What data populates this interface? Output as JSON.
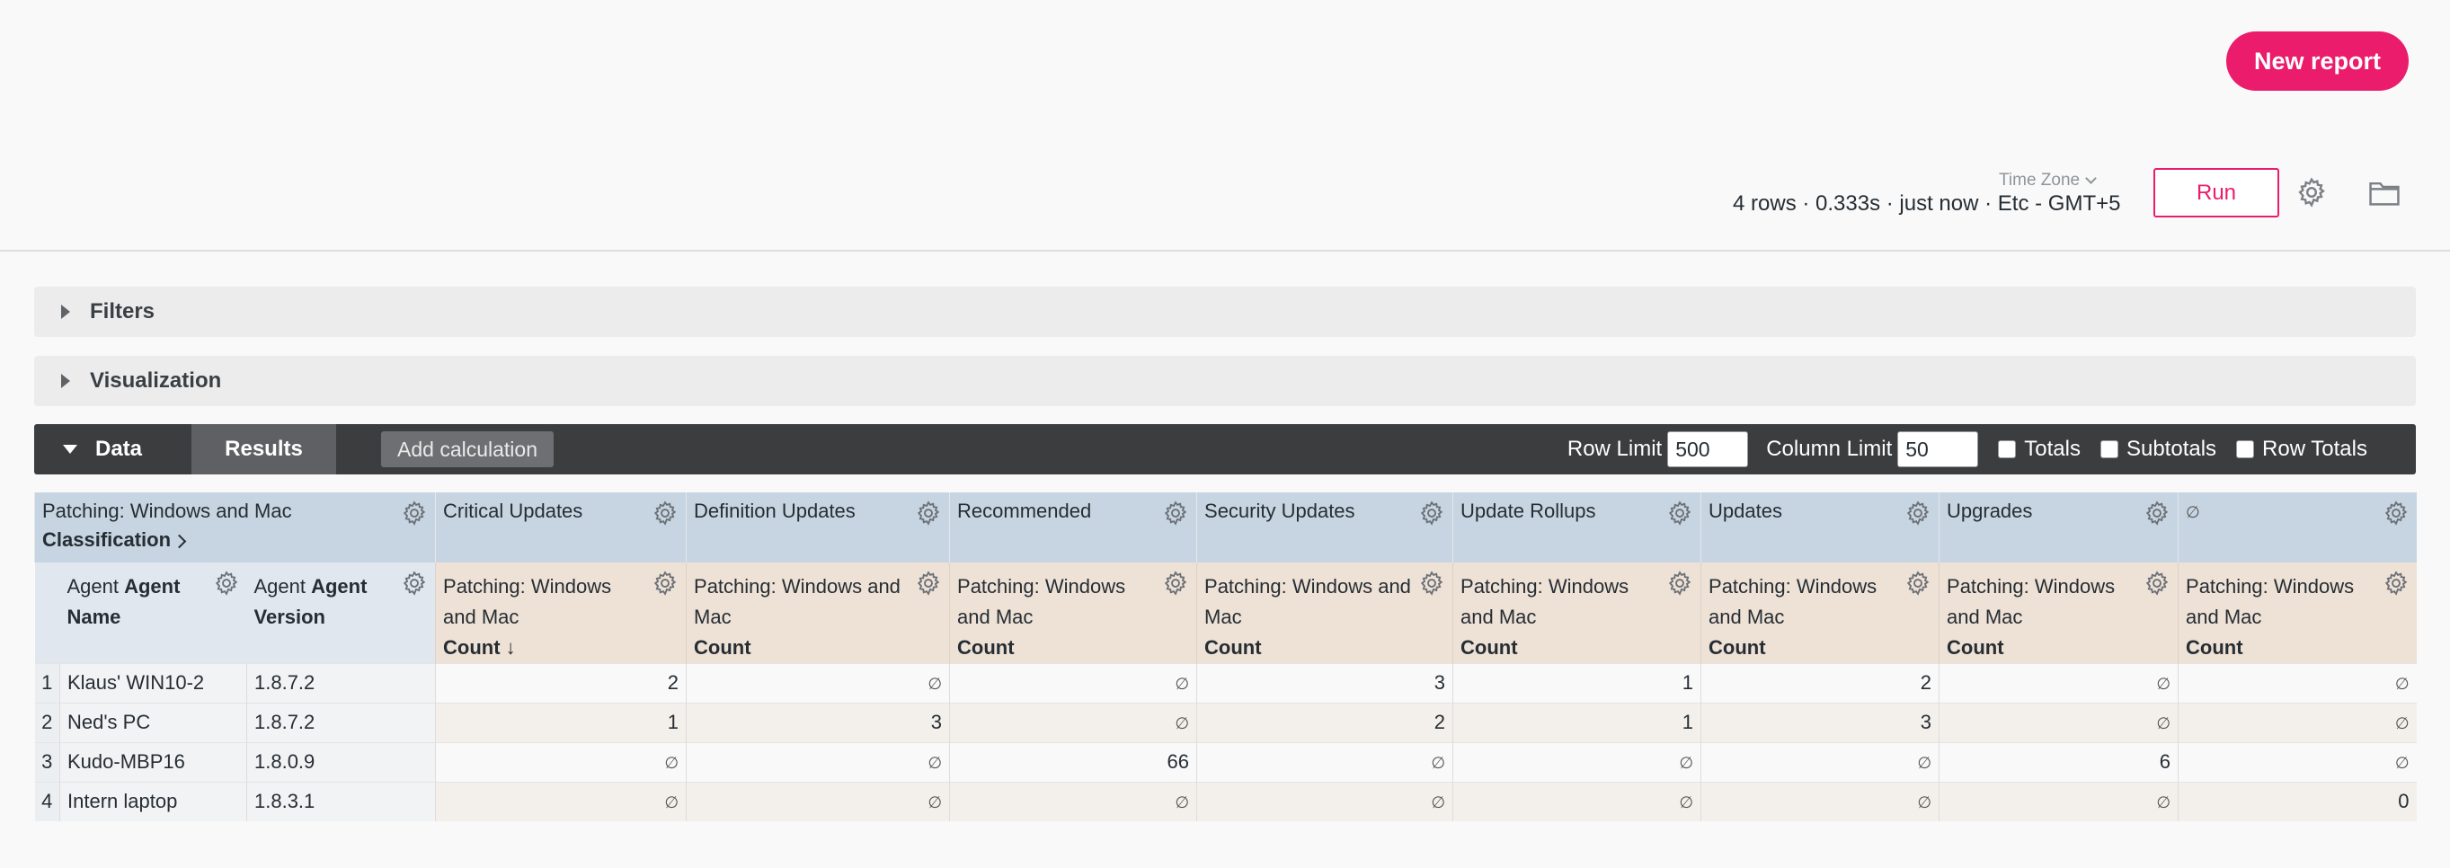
{
  "header": {
    "new_report_label": "New report",
    "timezone_label": "Time Zone",
    "status_line": "4 rows · 0.333s · just now · Etc - GMT+5",
    "run_label": "Run"
  },
  "sections": {
    "filters_label": "Filters",
    "visualization_label": "Visualization"
  },
  "data_bar": {
    "data_tab_label": "Data",
    "results_tab_label": "Results",
    "add_calculation_label": "Add calculation",
    "row_limit_label": "Row Limit",
    "row_limit_value": "500",
    "column_limit_label": "Column Limit",
    "column_limit_value": "50",
    "totals_label": "Totals",
    "subtotals_label": "Subtotals",
    "row_totals_label": "Row Totals"
  },
  "table": {
    "pivot_field_label": "Patching: Windows and Mac",
    "pivot_field_bold": "Classification",
    "pivot_values": [
      "Critical Updates",
      "Definition Updates",
      "Recommended",
      "Security Updates",
      "Update Rollups",
      "Updates",
      "Upgrades",
      "∅"
    ],
    "dimension_headers": [
      {
        "prefix": "Agent ",
        "bold": "Agent",
        "suffix": "Name"
      },
      {
        "prefix": "Agent ",
        "bold": "Agent",
        "suffix": "Version"
      }
    ],
    "measure_header_lines": [
      "Patching: Windows",
      "and Mac"
    ],
    "measure_header_lines_alt": [
      "Patching: Windows and",
      "Mac"
    ],
    "measure_name": "Count",
    "sort_indicator": "↓",
    "null_symbol": "∅",
    "rows": [
      {
        "n": "1",
        "name": "Klaus' WIN10-2",
        "version": "1.8.7.2",
        "values": [
          "2",
          "∅",
          "∅",
          "3",
          "1",
          "2",
          "∅",
          "∅"
        ]
      },
      {
        "n": "2",
        "name": "Ned's PC",
        "version": "1.8.7.2",
        "values": [
          "1",
          "3",
          "∅",
          "2",
          "1",
          "3",
          "∅",
          "∅"
        ]
      },
      {
        "n": "3",
        "name": "Kudo-MBP16",
        "version": "1.8.0.9",
        "values": [
          "∅",
          "∅",
          "66",
          "∅",
          "∅",
          "∅",
          "6",
          "∅"
        ]
      },
      {
        "n": "4",
        "name": "Intern laptop",
        "version": "1.8.3.1",
        "values": [
          "∅",
          "∅",
          "∅",
          "∅",
          "∅",
          "∅",
          "∅",
          "0"
        ]
      }
    ]
  }
}
